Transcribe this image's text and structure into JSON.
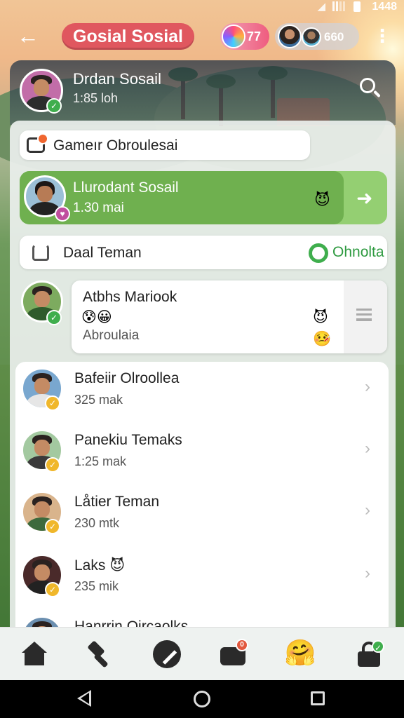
{
  "status_bar": {
    "time": "1448"
  },
  "header": {
    "title": "Gosial Sosial",
    "coins": "77",
    "friends_online": "660"
  },
  "profile": {
    "name": "Drdan Sosail",
    "subtitle": "1:85  loh"
  },
  "games_row": {
    "label": "Gameır Obroulesai"
  },
  "highlight": {
    "name": "Llurodant Sosail",
    "subtitle": "1.30 mai",
    "emoji": "😈"
  },
  "add_friend": {
    "label": "Daal Teman",
    "online_label": "Ohnolta"
  },
  "featured": {
    "name": "Atbhs Mariook",
    "emojis": "😰😀",
    "subtitle": "Abroulaia",
    "emoji_right_1": "😈",
    "emoji_right_2": "🤒"
  },
  "friends": [
    {
      "name": "Bafeiir Olroollea",
      "subtitle": "325 mak"
    },
    {
      "name": "Panekiu Temaks",
      "subtitle": "1:25 mak"
    },
    {
      "name": "Låtier Teman",
      "subtitle": "230 mtk"
    },
    {
      "name": "Laks 😈",
      "subtitle": "235 mik"
    },
    {
      "name": "Hanrrin Oircaolks",
      "subtitle": ""
    }
  ],
  "bottom_nav": {
    "bot_badge": "0",
    "emoji": "🤗"
  },
  "colors": {
    "title_pill": "#e0575f",
    "highlight_green": "#6fb04f",
    "online_green": "#3fae4d",
    "badge_gold": "#f0b72b"
  }
}
